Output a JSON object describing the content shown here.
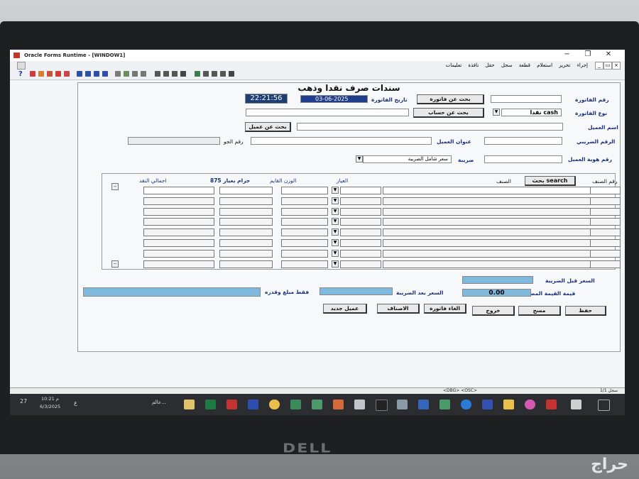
{
  "window": {
    "title": "Oracle Forms Runtime - [WINDOW1]",
    "controls": [
      "−",
      "❐",
      "✕"
    ]
  },
  "menu": {
    "items": [
      "إجراء",
      "تحرير",
      "استعلام",
      "قطعة",
      "سجل",
      "حقل",
      "نافذة",
      "تعليمات"
    ],
    "help_glyph": "?"
  },
  "form": {
    "title": "سندات صرف نقدا وذهب",
    "time": "22:21:56",
    "invoice_number_label": "رقم الفاتورة",
    "search_invoice_button": "بحث عن فاتورة",
    "invoice_date_label": "تاريخ الفاتورة",
    "invoice_date": "03-06-2025",
    "invoice_type_label": "نوع الفاتورة",
    "invoice_type_value": "نقدا cash",
    "search_account_button": "بحث عن حساب",
    "customer_name_label": "اسم العميل",
    "search_customer_button": "بحث عن عميل",
    "tax_number_label": "الرقم الضريبي",
    "customer_address_label": "عنوان العميل",
    "mobile_label": "رقم الجو",
    "customer_id_label": "رقم هوية العميل",
    "tax_label": "ضريبة",
    "tax_value": "سعر شامل الضريبة"
  },
  "grid": {
    "headers": {
      "item_number": "رقم الصنف",
      "search": "بحث search",
      "item": "الصنف",
      "karat": "العيار",
      "weight": "الوزن القايم",
      "grams_875": "جرام بعيار 875",
      "total_cash": "اجمالي النقد"
    },
    "row_count": 8
  },
  "totals": {
    "price_before_tax_label": "السعر قبل الضريبة",
    "vat_label": "قيمة القيمة المضافة",
    "vat_value": "0.00",
    "price_after_tax_label": "السعر بعد الضريبة",
    "amount_words_label": "فقط مبلغ وقدره"
  },
  "actions": {
    "save": "حفظ",
    "clear": "مسح",
    "exit": "خروج",
    "cancel_invoice": "الغاء فاتورة",
    "items": "الاصناف",
    "new_customer": "عميل جديد"
  },
  "status": {
    "record": "سجل 1/1",
    "mode": "<DBG> <OSC>"
  },
  "taskbar": {
    "time": "10:21 م",
    "date": "6/3/2025",
    "weather": "عالم...",
    "temp": "27"
  },
  "brand": "DELL",
  "watermark": "حراج"
}
